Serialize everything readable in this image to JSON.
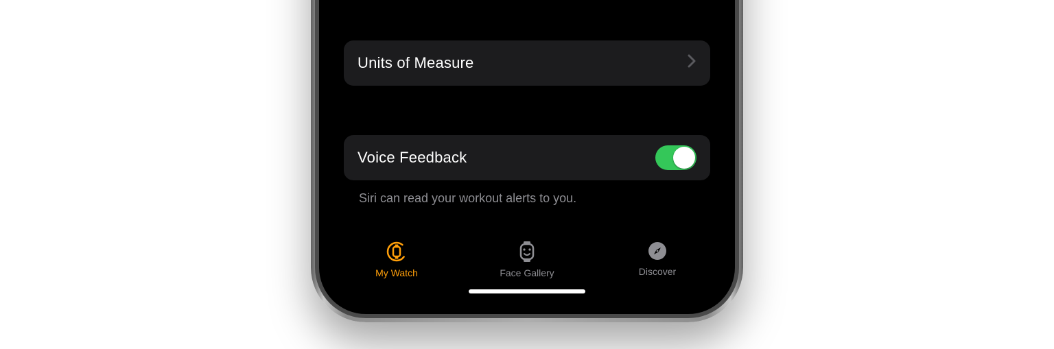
{
  "colors": {
    "accent": "#ff9f0a",
    "toggle_on": "#34c759",
    "row_bg": "#1c1c1e",
    "footer_text": "#8e8e93"
  },
  "settings": {
    "units_of_measure": {
      "label": "Units of Measure"
    },
    "voice_feedback": {
      "label": "Voice Feedback",
      "enabled": true
    },
    "voice_feedback_footer": "Siri can read your workout alerts to you."
  },
  "tabs": {
    "my_watch": {
      "label": "My Watch",
      "active": true
    },
    "face_gallery": {
      "label": "Face Gallery",
      "active": false
    },
    "discover": {
      "label": "Discover",
      "active": false
    }
  }
}
